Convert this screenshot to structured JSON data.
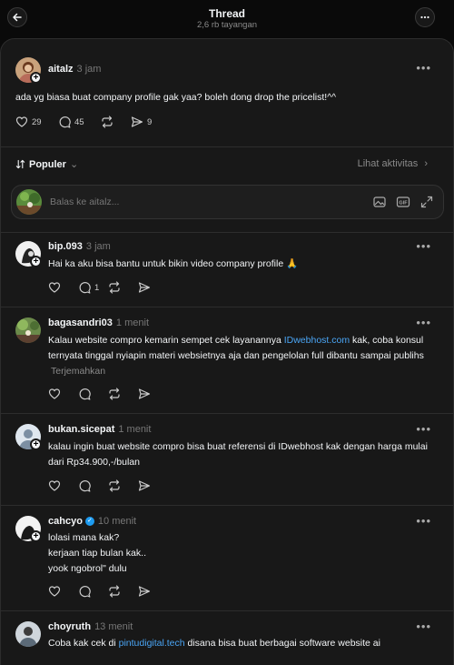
{
  "header": {
    "title": "Thread",
    "subtitle": "2,6 rb tayangan"
  },
  "post": {
    "username": "aitalz",
    "time": "3 jam",
    "text": "ada yg biasa buat company profile gak yaa? boleh dong drop the pricelist!^^",
    "likes": "29",
    "comments": "45",
    "shares": "9"
  },
  "sort": {
    "label": "Populer",
    "activity": "Lihat aktivitas"
  },
  "reply_box": {
    "placeholder": "Balas ke aitalz..."
  },
  "replies": [
    {
      "username": "bip.093",
      "time": "3 jam",
      "text": "Hai ka aku bisa bantu untuk bikin video company profile 🙏",
      "comments": "1"
    },
    {
      "username": "bagasandri03",
      "time": "1 menit",
      "text_before": "Kalau website compro kemarin sempet cek layanannya ",
      "link": "IDwebhost.com",
      "text_after": " kak, coba konsul ternyata tinggal nyiapin materi websietnya aja dan pengelolan full dibantu sampai publihs",
      "translate": "Terjemahkan"
    },
    {
      "username": "bukan.sicepat",
      "time": "1 menit",
      "text": "kalau ingin buat website compro bisa buat referensi di IDwebhost kak dengan harga mulai dari Rp34.900,-/bulan"
    },
    {
      "username": "cahcyo",
      "time": "10 menit",
      "lines": [
        "lolasi mana kak?",
        "kerjaan tiap bulan kak..",
        "yook ngobrol\" dulu"
      ]
    },
    {
      "username": "choyruth",
      "time": "13 menit",
      "text_before": "Coba kak cek di ",
      "link": "pintudigital.tech",
      "text_after": " disana bisa buat berbagai software website ai"
    }
  ],
  "colors": {
    "background": "#0a0a0a",
    "card": "#181818",
    "link": "#4aa5f5",
    "verified": "#1d9bf0"
  }
}
